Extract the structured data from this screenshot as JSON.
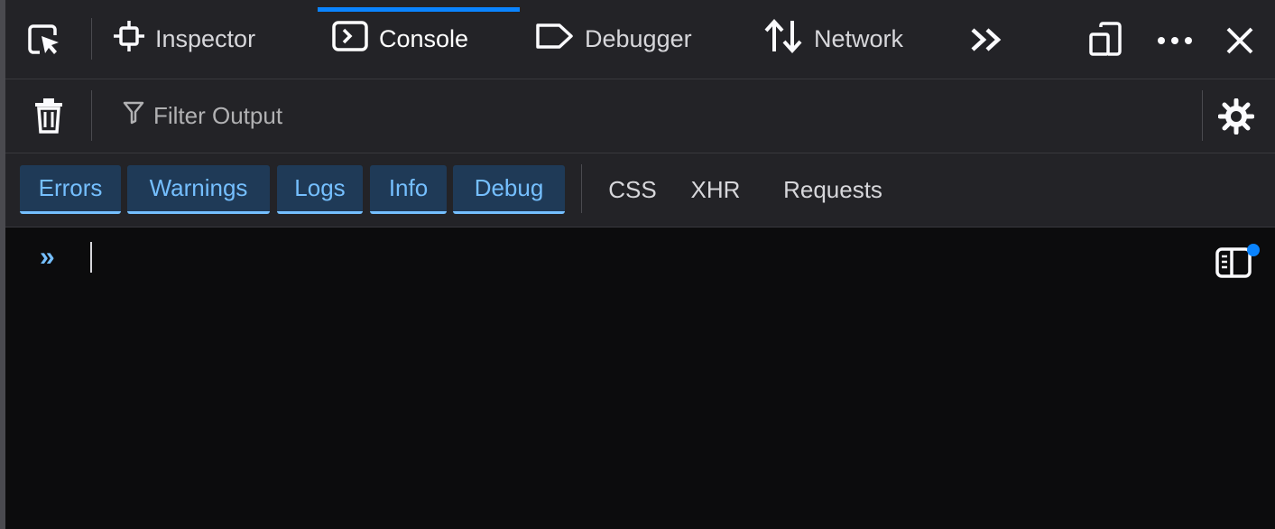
{
  "toolbox": {
    "picker_icon": "element-picker-icon",
    "tabs": [
      {
        "label": "Inspector",
        "icon": "inspector-icon"
      },
      {
        "label": "Console",
        "icon": "console-icon",
        "selected": true
      },
      {
        "label": "Debugger",
        "icon": "debugger-icon"
      },
      {
        "label": "Network",
        "icon": "network-icon"
      }
    ],
    "overflow_icon": "chevron-double-right-icon",
    "responsive_icon": "responsive-design-icon",
    "menu_icon": "more-options-icon",
    "close_icon": "close-icon",
    "accent_color": "#0a84ff"
  },
  "filterbar": {
    "clear_icon": "trash-icon",
    "filter_icon": "funnel-icon",
    "filter_placeholder": "Filter Output",
    "settings_icon": "gear-icon"
  },
  "levels": [
    {
      "label": "Errors",
      "active": true
    },
    {
      "label": "Warnings",
      "active": true
    },
    {
      "label": "Logs",
      "active": true
    },
    {
      "label": "Info",
      "active": true
    },
    {
      "label": "Debug",
      "active": true
    },
    {
      "label": "CSS",
      "active": false
    },
    {
      "label": "XHR",
      "active": false
    },
    {
      "label": "Requests",
      "active": false
    }
  ],
  "console": {
    "prompt": "»",
    "input_value": "",
    "sidebar_toggle_icon": "sidebar-toggle-icon"
  }
}
